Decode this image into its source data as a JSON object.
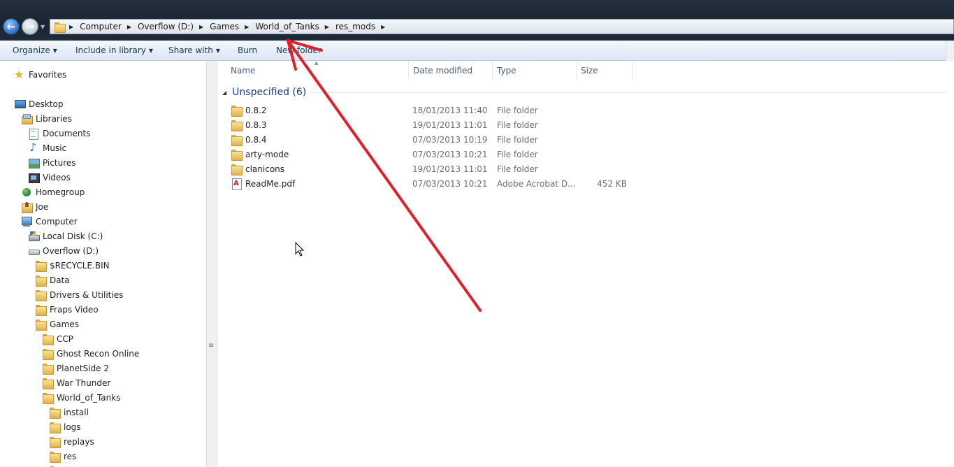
{
  "address": {
    "crumbs": [
      "Computer",
      "Overflow (D:)",
      "Games",
      "World_of_Tanks",
      "res_mods"
    ]
  },
  "commands": {
    "organize": "Organize",
    "include_in_library": "Include in library",
    "share_with": "Share with",
    "burn": "Burn",
    "new_folder": "New folder"
  },
  "nav": {
    "favorites": "Favorites",
    "desktop": "Desktop",
    "libraries": "Libraries",
    "documents": "Documents",
    "music": "Music",
    "pictures": "Pictures",
    "videos": "Videos",
    "homegroup": "Homegroup",
    "joe": "Joe",
    "computer": "Computer",
    "local_disk": "Local Disk (C:)",
    "overflow": "Overflow (D:)",
    "recycle": "$RECYCLE.BIN",
    "data": "Data",
    "drivers": "Drivers & Utilities",
    "fraps": "Fraps Video",
    "games": "Games",
    "ccp": "CCP",
    "ghost": "Ghost Recon Online",
    "planetside": "PlanetSide 2",
    "warthunder": "War Thunder",
    "wot": "World_of_Tanks",
    "install": "install",
    "logs": "logs",
    "replays": "replays",
    "res": "res"
  },
  "columns": {
    "name": "Name",
    "date": "Date modified",
    "type": "Type",
    "size": "Size"
  },
  "group": {
    "title": "Unspecified (6)"
  },
  "files": [
    {
      "name": "0.8.2",
      "date": "18/01/2013 11:40",
      "type": "File folder",
      "size": "",
      "icon": "folder-icon"
    },
    {
      "name": "0.8.3",
      "date": "19/01/2013 11:01",
      "type": "File folder",
      "size": "",
      "icon": "folder-icon"
    },
    {
      "name": "0.8.4",
      "date": "07/03/2013 10:19",
      "type": "File folder",
      "size": "",
      "icon": "folder-icon"
    },
    {
      "name": "arty-mode",
      "date": "07/03/2013 10:21",
      "type": "File folder",
      "size": "",
      "icon": "folder-icon"
    },
    {
      "name": "clanicons",
      "date": "19/01/2013 11:01",
      "type": "File folder",
      "size": "",
      "icon": "folder-icon"
    },
    {
      "name": "ReadMe.pdf",
      "date": "07/03/2013 10:21",
      "type": "Adobe Acrobat D...",
      "size": "452 KB",
      "icon": "pdf-icon"
    }
  ],
  "colors": {
    "annotation_arrow": "#e0202a",
    "group_title": "#1e3a8a",
    "command_bar": "#e6eef8"
  }
}
